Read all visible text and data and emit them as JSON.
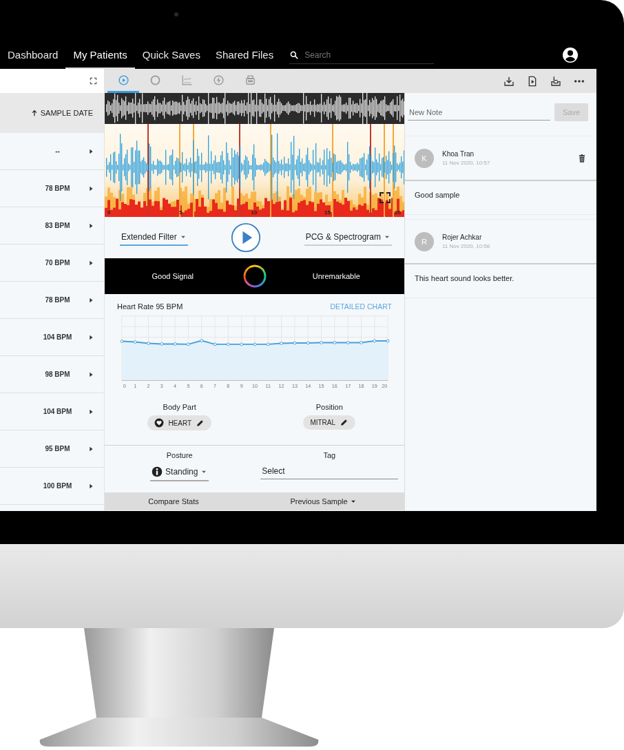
{
  "nav": {
    "items": [
      {
        "label": "Dashboard",
        "selected": false
      },
      {
        "label": "My Patients",
        "selected": true
      },
      {
        "label": "Quick Saves",
        "selected": false
      },
      {
        "label": "Shared Files",
        "selected": false
      }
    ],
    "search": {
      "placeholder": "Search"
    }
  },
  "patient_list": {
    "sort_column": "SAMPLE DATE",
    "rows": [
      {
        "heart_rate": "--"
      },
      {
        "heart_rate": "78 BPM"
      },
      {
        "heart_rate": "83 BPM"
      },
      {
        "heart_rate": "70 BPM"
      },
      {
        "heart_rate": "78 BPM"
      },
      {
        "heart_rate": "104 BPM"
      },
      {
        "heart_rate": "98 BPM"
      },
      {
        "heart_rate": "104 BPM"
      },
      {
        "heart_rate": "95 BPM"
      },
      {
        "heart_rate": "100 BPM"
      }
    ]
  },
  "toolbar": {
    "tabs": [
      {
        "selected": true
      },
      {
        "selected": false
      },
      {
        "selected": false
      },
      {
        "selected": false
      },
      {
        "selected": false
      }
    ]
  },
  "waveform": {
    "axis_labels": [
      "0",
      "5",
      "10",
      "15",
      "20"
    ]
  },
  "controls": {
    "filter": "Extended Filter",
    "view": "PCG & Spectrogram"
  },
  "signal_bar": {
    "quality": "Good Signal",
    "finding": "Unremarkable"
  },
  "heart_rate": {
    "title": "Heart Rate 95 BPM",
    "link": "DETAILED CHART",
    "x_labels": [
      "0",
      "1",
      "2",
      "3",
      "4",
      "5",
      "6",
      "7",
      "8",
      "9",
      "10",
      "11",
      "12",
      "13",
      "14",
      "15",
      "16",
      "17",
      "18",
      "19",
      "20"
    ]
  },
  "body_part": {
    "label": "Body Part",
    "value": "HEART"
  },
  "position": {
    "label": "Position",
    "value": "MITRAL"
  },
  "posture": {
    "label": "Posture",
    "value": "Standing"
  },
  "tag": {
    "label": "Tag",
    "value": "Select"
  },
  "compare": {
    "label": "Compare Stats",
    "value": "Previous Sample"
  },
  "notes": {
    "new_note": {
      "placeholder": "New Note"
    },
    "save": {
      "label": "Save",
      "disabled": true
    },
    "items": [
      {
        "initial": "K",
        "author": "Khoa Tran",
        "time": "11 Nov 2020, 10:57",
        "text": "Good sample",
        "deletable": true
      },
      {
        "initial": "R",
        "author": "Rojer Achkar",
        "time": "11 Nov 2020, 10:58",
        "text": "This heart sound looks better.",
        "deletable": false
      }
    ]
  }
}
